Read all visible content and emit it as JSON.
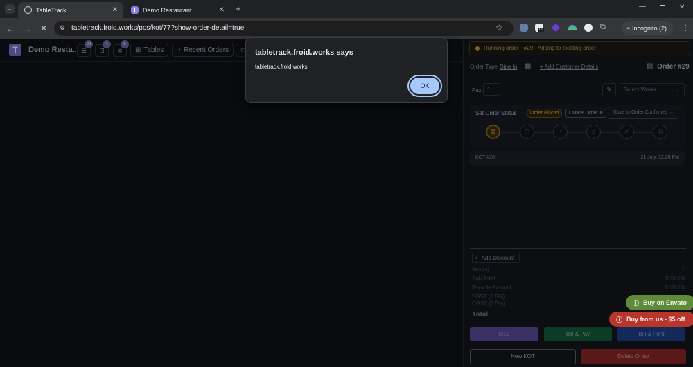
{
  "browser": {
    "tabs": [
      {
        "title": "TableTrack"
      },
      {
        "title": "Demo Restaurant",
        "fav": "T"
      }
    ],
    "url": "tabletrack.froid.works/pos/kot/77?show-order-detail=true",
    "ext_badge": "10",
    "incognito": "Incognito (2)"
  },
  "app": {
    "brand": "Demo Resta...",
    "logo": "T",
    "badges": [
      "29",
      "4",
      "6"
    ],
    "nav": {
      "tables": "Tables",
      "recent": "Recent Orders"
    }
  },
  "order": {
    "running": "Running order · #29 · Adding to existing order",
    "order_type_label": "Order Type",
    "order_type": "Dine In",
    "add_customer": "+ Add Customer Details",
    "order_no": "Order #29",
    "pax_label": "Pax",
    "pax_value": "1",
    "waiter_placeholder": "Select Waiter",
    "status_label": "Set Order Status",
    "status_badge": "Order Placed",
    "cancel": "Cancel Order ✕",
    "move": "Move to Order Confirmed →",
    "kot": "KOT #26",
    "kot_time": "21 July, 12:26 PM",
    "add_discount": "Add Discount",
    "summary": [
      {
        "label": "Item(s)",
        "value": "1"
      },
      {
        "label": "Sub Total",
        "value": "$150.00"
      },
      {
        "label": "Taxable Amount",
        "value": "$150.00"
      },
      {
        "label": "SGST (2.5%)",
        "value": ""
      },
      {
        "label": "CGST (2.5%)",
        "value": ""
      }
    ],
    "total_label": "Total",
    "buttons": {
      "bill": "BILL",
      "bill_pay": "Bill & Pay",
      "bill_print": "Bill & Print",
      "new_kot": "New KOT",
      "delete": "Delete Order"
    }
  },
  "promo": {
    "envato": "Buy on Envato",
    "us": "Buy from us - $5 off"
  },
  "dialog": {
    "title": "tabletrack.froid.works says",
    "message": "tabletrack.froid.works",
    "ok": "OK"
  }
}
